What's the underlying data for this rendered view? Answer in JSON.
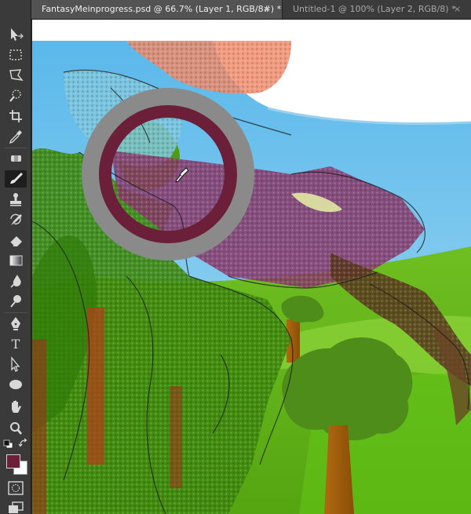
{
  "tabs": [
    {
      "label": "FantasyMeinprogress.psd @ 66.7% (Layer 1, RGB/8#) *",
      "close": "×",
      "active": true
    },
    {
      "label": "Untitled-1 @ 100% (Layer 2, RGB/8) *",
      "close": "×",
      "active": false
    }
  ],
  "toolbar": {
    "tools": [
      "move-tool",
      "marquee-tool",
      "lasso-tool",
      "quick-selection-tool",
      "crop-tool",
      "eyedropper-tool",
      "healing-brush-tool",
      "brush-tool",
      "clone-stamp-tool",
      "history-brush-tool",
      "eraser-tool",
      "gradient-tool",
      "blur-tool",
      "dodge-tool",
      "pen-tool",
      "type-tool",
      "path-selection-tool",
      "ellipse-tool",
      "hand-tool",
      "zoom-tool"
    ],
    "active_tool": "brush-tool",
    "type_tool_glyph": "T",
    "foreground_color": "#6b1f38",
    "background_color": "#ffffff"
  },
  "colors": {
    "sky": "#5ab8ea",
    "grass": "#5fb51a",
    "brush_ring": "#6b1f38",
    "brush_ring_outer": "#8a8a8a"
  }
}
